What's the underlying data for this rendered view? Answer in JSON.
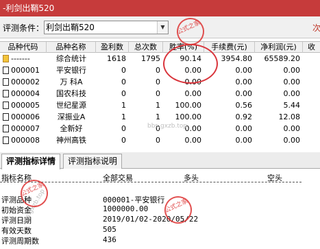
{
  "window": {
    "title": "-利剑出鞘520"
  },
  "toolbar": {
    "label": "评测条件：",
    "select_value": "利剑出鞘520",
    "right_text": "次"
  },
  "grid": {
    "headers": [
      "品种代码",
      "品种名称",
      "盈利数",
      "总次数",
      "胜率(%)",
      "手续费(元)",
      "净利润(元)",
      "收"
    ],
    "rows": [
      {
        "code": "-------",
        "name": "综合统计",
        "win": "1618",
        "total": "1795",
        "rate": "90.14",
        "fee": "3954.80",
        "profit": "65589.20"
      },
      {
        "code": "000001",
        "name": "平安银行",
        "win": "0",
        "total": "0",
        "rate": "0.00",
        "fee": "0.00",
        "profit": "0.00"
      },
      {
        "code": "000002",
        "name": "万 科A",
        "win": "0",
        "total": "0",
        "rate": "0.00",
        "fee": "0.00",
        "profit": "0.00"
      },
      {
        "code": "000004",
        "name": "国农科技",
        "win": "0",
        "total": "0",
        "rate": "0.00",
        "fee": "0.00",
        "profit": "0.00"
      },
      {
        "code": "000005",
        "name": "世纪星源",
        "win": "1",
        "total": "1",
        "rate": "100.00",
        "fee": "0.56",
        "profit": "5.44"
      },
      {
        "code": "000006",
        "name": "深振业A",
        "win": "1",
        "total": "1",
        "rate": "100.00",
        "fee": "0.92",
        "profit": "12.08"
      },
      {
        "code": "000007",
        "name": "全新好",
        "win": "0",
        "total": "0",
        "rate": "0.00",
        "fee": "0.00",
        "profit": "0.00"
      },
      {
        "code": "000008",
        "name": "神州高铁",
        "win": "0",
        "total": "0",
        "rate": "0.00",
        "fee": "0.00",
        "profit": "0.00"
      }
    ],
    "watermark": "bbs.gxzb.top"
  },
  "tabs": [
    {
      "label": "评测指标详情",
      "active": true
    },
    {
      "label": "评测指标说明",
      "active": false
    }
  ],
  "detail": {
    "headers": [
      "指标名称",
      "全部交易",
      "多头",
      "空头"
    ],
    "rows": [
      {
        "label": "评测品种",
        "value": "000001-平安银行"
      },
      {
        "label": "初始资金",
        "value": "1000000.00"
      },
      {
        "label": "评测日期",
        "value": "2019/01/02-2020/05/22"
      },
      {
        "label": "有效天数",
        "value": "505"
      },
      {
        "label": "评测周期数",
        "value": "436"
      }
    ],
    "watermark": "bbs.gxzb.top"
  },
  "stamp": {
    "text": "公式之家"
  },
  "colors": {
    "titlebar": "#c63b3b",
    "circle": "#d9343b"
  }
}
